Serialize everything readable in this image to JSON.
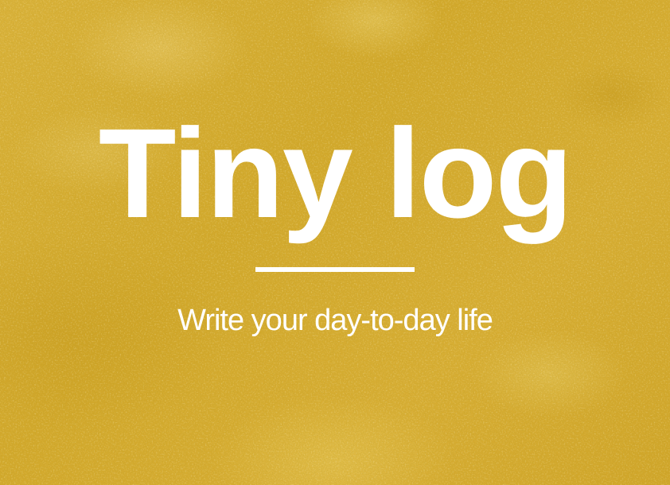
{
  "hero": {
    "title": "Tiny log",
    "subtitle": "Write your day-to-day life"
  },
  "colors": {
    "background": "#d5ac2f",
    "text": "#ffffff",
    "divider": "#ffffff"
  }
}
